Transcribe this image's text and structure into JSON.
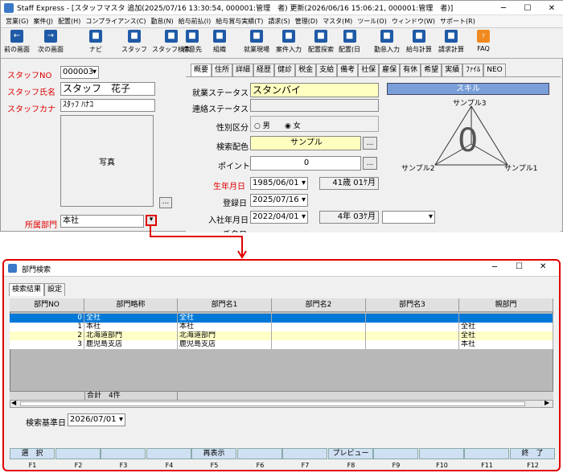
{
  "main_window": {
    "title": "Staff Express - [スタッフマスタ 追加(2025/07/16 13:30:54, 000001:管理　者) 更新(2026/06/16 15:06:21, 000001:管理　者)]",
    "menu": [
      "営業(G)",
      "案件(J)",
      "配置(H)",
      "コンプライアンス(C)",
      "勤怠(N)",
      "給与前払(I)",
      "給与賞与実績(T)",
      "請求(S)",
      "管理(D)",
      "マスタ(M)",
      "ツール(O)",
      "ウィンドウ(W)",
      "サポート(R)"
    ],
    "toolbar": [
      {
        "label": "前の画面",
        "icon": "left-arrow"
      },
      {
        "label": "次の画面",
        "icon": "right-arrow"
      },
      {
        "label": "ナビ",
        "icon": "nav"
      },
      {
        "label": "スタッフ",
        "icon": "staff"
      },
      {
        "label": "スタッフ検索",
        "icon": "staff-search"
      },
      {
        "label": "得意先",
        "icon": "customer"
      },
      {
        "label": "組織",
        "icon": "org"
      },
      {
        "label": "就業現場",
        "icon": "worksite"
      },
      {
        "label": "案件入力",
        "icon": "job-entry"
      },
      {
        "label": "配置探索",
        "icon": "placement-search"
      },
      {
        "label": "配置(日",
        "icon": "placement"
      },
      {
        "label": "勤怠入力",
        "icon": "attendance"
      },
      {
        "label": "給与計算",
        "icon": "payroll"
      },
      {
        "label": "請求計算",
        "icon": "billing"
      },
      {
        "label": "FAQ",
        "icon": "faq"
      }
    ],
    "left": {
      "staff_no_label": "スタッフNO",
      "staff_no": "000003",
      "staff_name_label": "スタッフ氏名",
      "staff_name": "スタッフ　花子",
      "staff_kana_label": "スタッフカナ",
      "staff_kana": "ｽﾀｯﾌ ﾊﾅｺ",
      "photo_label": "写真",
      "photo_btn": "...",
      "dept_label": "所属部門",
      "dept": "本社"
    },
    "tabs": [
      "概要",
      "住所",
      "詳細",
      "経歴",
      "健診",
      "税金",
      "支給",
      "備考",
      "社保",
      "雇保",
      "有休",
      "希望",
      "実績",
      "ﾌｧｲﾙ",
      "NEO"
    ],
    "form": {
      "status_label": "就業ステータス",
      "status": "スタンバイ",
      "contact_label": "連絡ステータス",
      "contact": "",
      "gender_label": "性別区分",
      "gender_male": "男",
      "gender_female": "女",
      "search_color_label": "検索配色",
      "search_color": "サンプル",
      "point_label": "ポイント",
      "point": "0",
      "birth_label": "生年月日",
      "birth": "1985/06/01",
      "age": "41歳 01ｹ月",
      "reg_label": "登録日",
      "reg": "2025/07/16",
      "join_label": "入社年月日",
      "join": "2022/04/01",
      "tenure": "4年 03ｹ月",
      "next_label": "氏名日",
      "next_val": "/ /"
    },
    "skill": {
      "header": "スキル",
      "top": "サンプル3",
      "left": "サンプル2",
      "right": "サンプル1",
      "center": "0"
    }
  },
  "dialog": {
    "title": "部門検索",
    "tabs": [
      "検索結果",
      "設定"
    ],
    "columns": [
      "部門NO",
      "部門略称",
      "部門名1",
      "部門名2",
      "部門名3",
      "親部門"
    ],
    "rows": [
      [
        "0",
        "全社",
        "全社",
        "",
        "",
        ""
      ],
      [
        "1",
        "本社",
        "本社",
        "",
        "",
        "全社"
      ],
      [
        "2",
        "北海道部門",
        "北海道部門",
        "",
        "",
        "全社"
      ],
      [
        "3",
        "鹿児島支店",
        "鹿児島支店",
        "",
        "",
        "本社"
      ]
    ],
    "total": "合計　4件",
    "base_date_label": "検索基準日",
    "base_date": "2026/07/01",
    "fkeys": [
      {
        "label": "選　択",
        "key": "F1"
      },
      {
        "label": "",
        "key": "F2"
      },
      {
        "label": "",
        "key": "F3"
      },
      {
        "label": "",
        "key": "F4"
      },
      {
        "label": "再表示",
        "key": "F5"
      },
      {
        "label": "",
        "key": "F6"
      },
      {
        "label": "",
        "key": "F7"
      },
      {
        "label": "プレビュー",
        "key": "F8"
      },
      {
        "label": "",
        "key": "F9"
      },
      {
        "label": "",
        "key": "F10"
      },
      {
        "label": "",
        "key": "F11"
      },
      {
        "label": "終　了",
        "key": "F12"
      }
    ]
  },
  "colors": {
    "accent_red": "#e00000",
    "selection": "#0078d7",
    "yellow": "#ffffc0",
    "fkey": "#cfe0f3"
  }
}
